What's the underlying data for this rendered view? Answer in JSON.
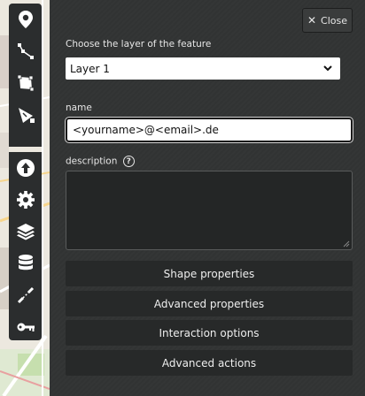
{
  "close_button": {
    "label": "Close",
    "icon": "close-icon"
  },
  "layer": {
    "label": "Choose the layer of the feature",
    "selected": "Layer 1"
  },
  "name_field": {
    "label": "name",
    "value": "<yourname>@<email>.de"
  },
  "description_field": {
    "label": "description",
    "value": ""
  },
  "actions": [
    {
      "label": "Shape properties"
    },
    {
      "label": "Advanced properties"
    },
    {
      "label": "Interaction options"
    },
    {
      "label": "Advanced actions"
    }
  ],
  "toolbar": {
    "icons": [
      "marker-icon",
      "polyline-icon",
      "polygon-icon",
      "measure-icon",
      "upload-icon",
      "settings-icon",
      "layers-icon",
      "database-icon",
      "link-icon",
      "key-icon"
    ]
  },
  "colors": {
    "panel": "#323434",
    "button": "#272929",
    "toolbar": "#2b2d2e",
    "text": "#e6e6e6"
  }
}
